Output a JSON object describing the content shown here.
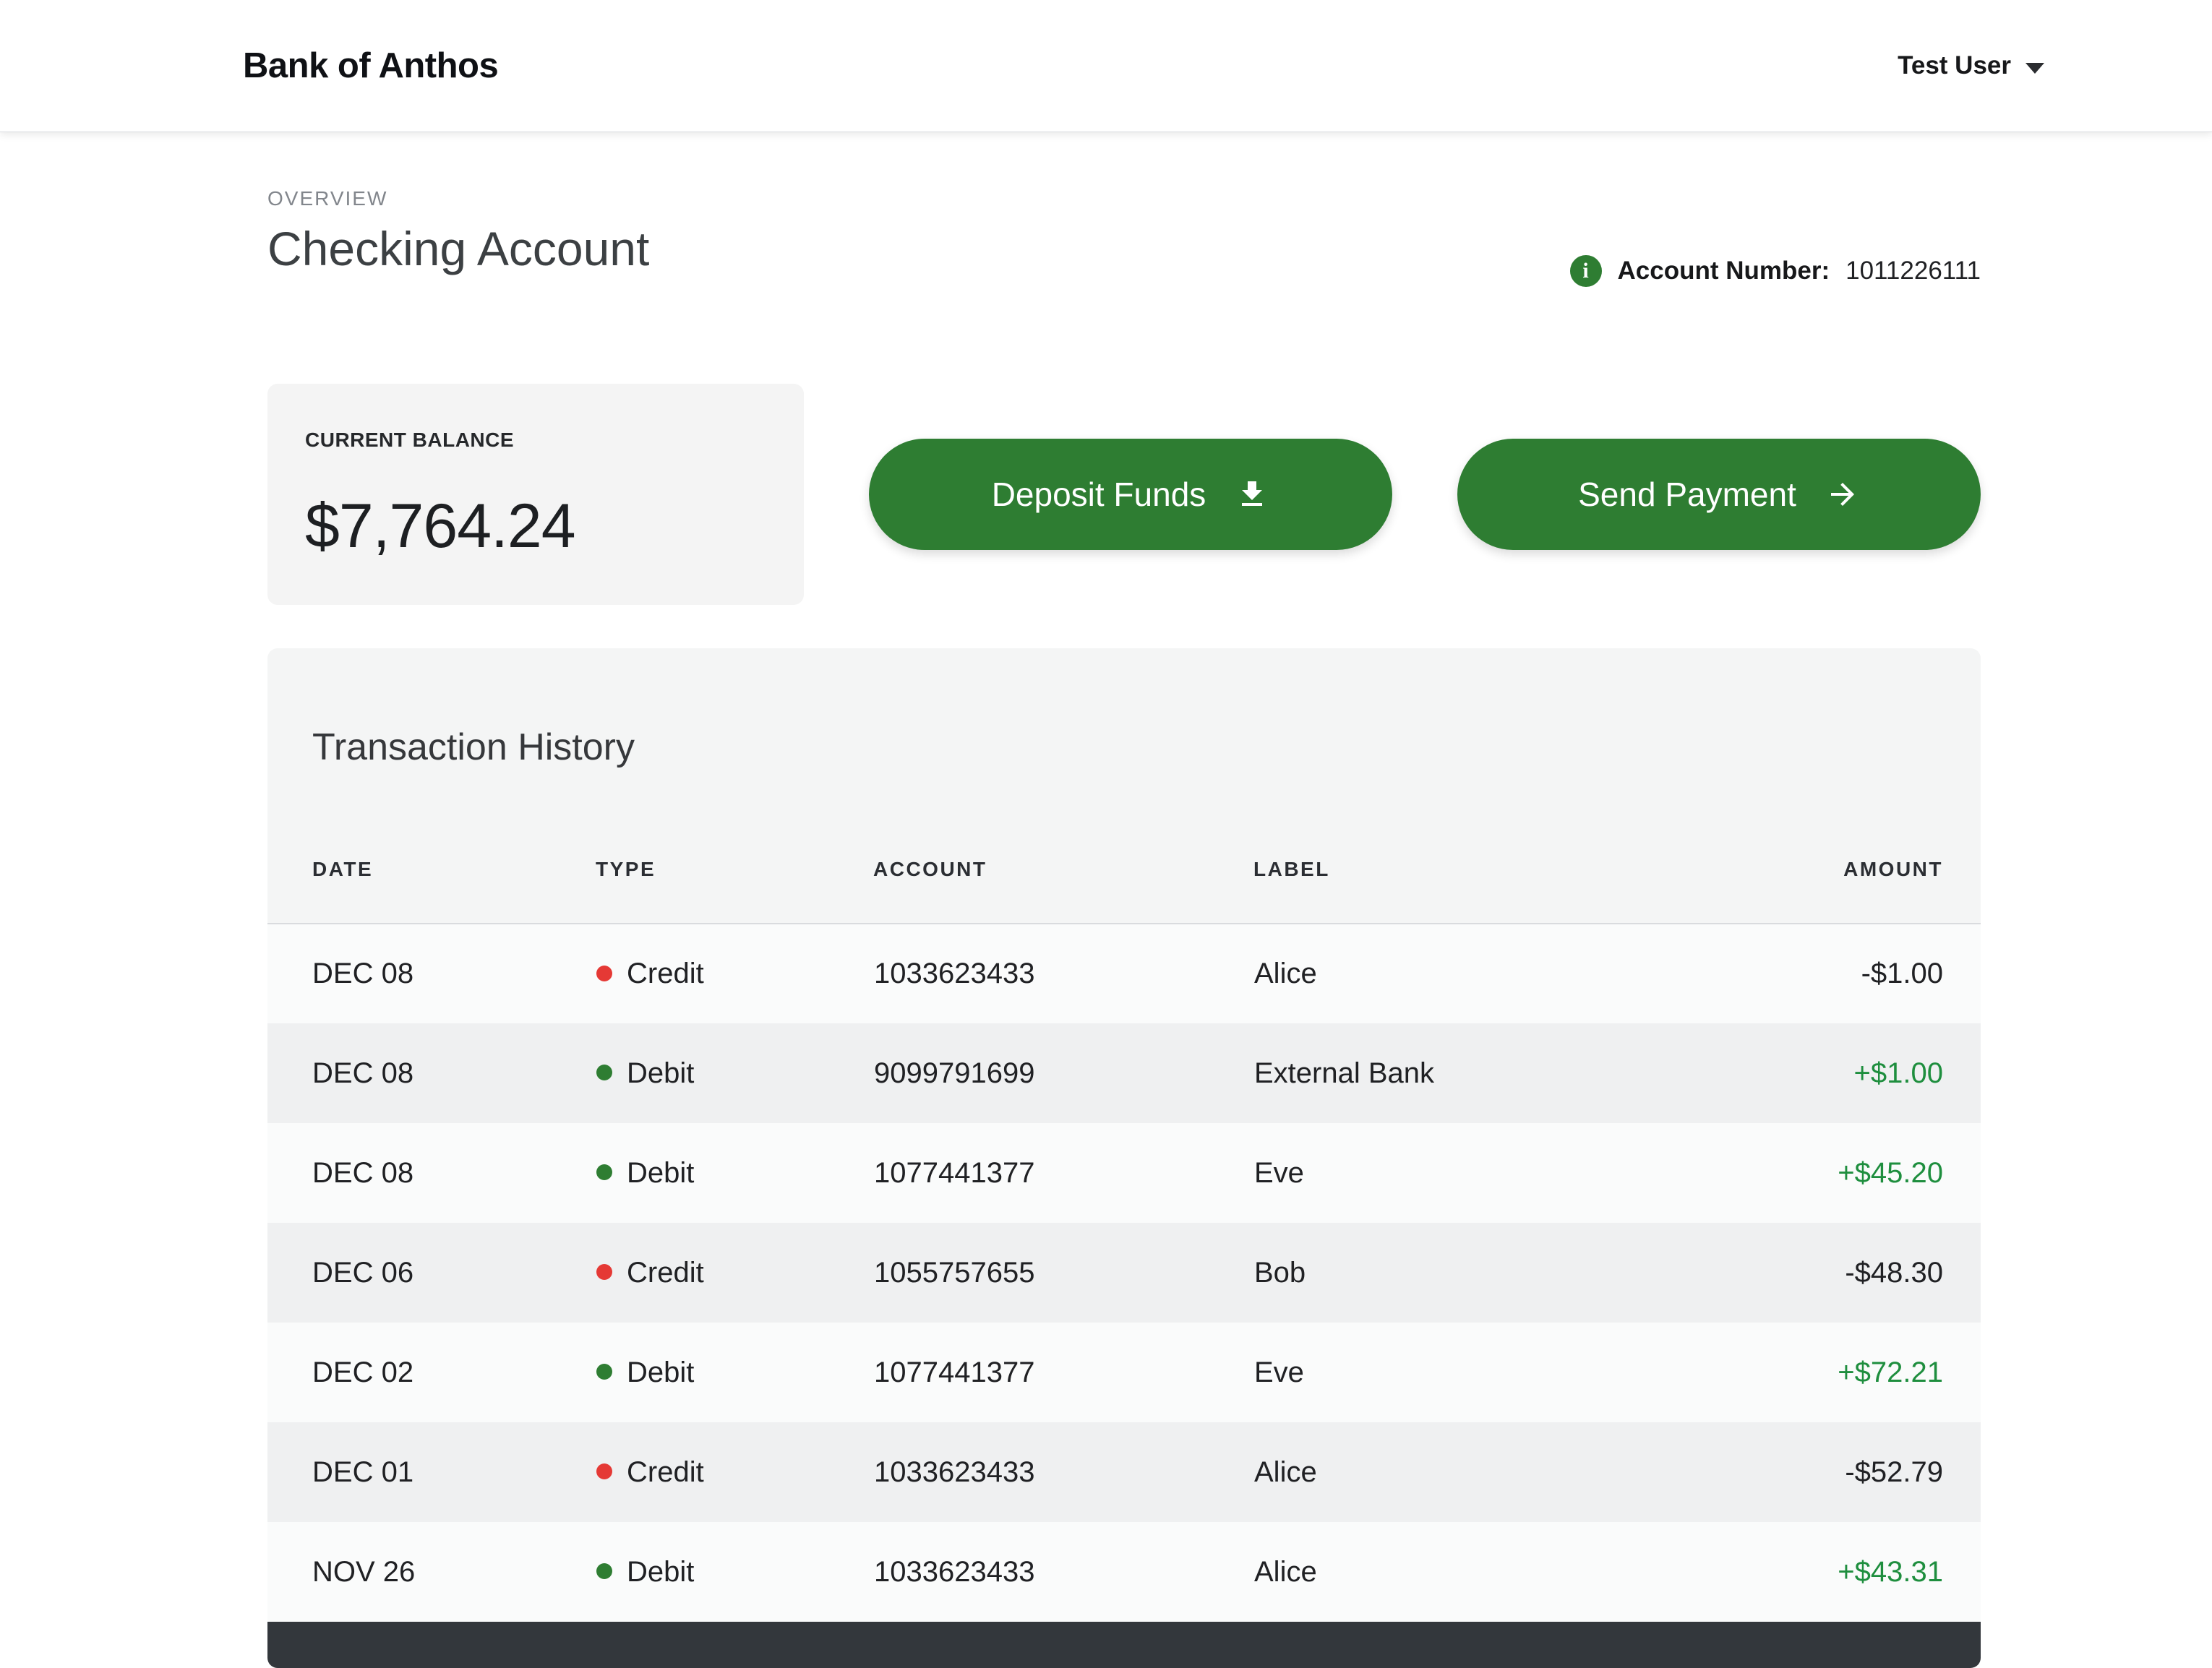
{
  "header": {
    "brand": "Bank of Anthos",
    "user_menu_label": "Test User"
  },
  "overview": {
    "eyebrow": "OVERVIEW",
    "title": "Checking Account",
    "account_number_label": "Account Number:",
    "account_number_value": "1011226111"
  },
  "balance": {
    "label": "CURRENT BALANCE",
    "amount": "$7,764.24"
  },
  "actions": {
    "deposit_label": "Deposit Funds",
    "send_label": "Send Payment"
  },
  "transactions": {
    "title": "Transaction History",
    "columns": [
      "DATE",
      "TYPE",
      "ACCOUNT",
      "LABEL",
      "AMOUNT"
    ],
    "rows": [
      {
        "date": "DEC 08",
        "type": "Credit",
        "account": "1033623433",
        "label": "Alice",
        "amount": "-$1.00"
      },
      {
        "date": "DEC 08",
        "type": "Debit",
        "account": "9099791699",
        "label": "External Bank",
        "amount": "+$1.00"
      },
      {
        "date": "DEC 08",
        "type": "Debit",
        "account": "1077441377",
        "label": "Eve",
        "amount": "+$45.20"
      },
      {
        "date": "DEC 06",
        "type": "Credit",
        "account": "1055757655",
        "label": "Bob",
        "amount": "-$48.30"
      },
      {
        "date": "DEC 02",
        "type": "Debit",
        "account": "1077441377",
        "label": "Eve",
        "amount": "+$72.21"
      },
      {
        "date": "DEC 01",
        "type": "Credit",
        "account": "1033623433",
        "label": "Alice",
        "amount": "-$52.79"
      },
      {
        "date": "NOV 26",
        "type": "Debit",
        "account": "1033623433",
        "label": "Alice",
        "amount": "+$43.31"
      }
    ]
  },
  "icons": {
    "account_info": "info-icon",
    "deposit": "download-icon",
    "send": "arrow-right-icon",
    "user_menu": "chevron-down-icon",
    "credit_marker": "red-dot-icon",
    "debit_marker": "green-dot-icon"
  },
  "colors": {
    "button_green": "#2e7d32",
    "positive_amount_green": "#1e8e3e",
    "credit_dot_red": "#e53935",
    "debit_dot_green": "#2e7d32",
    "card_background": "#f4f5f5"
  }
}
